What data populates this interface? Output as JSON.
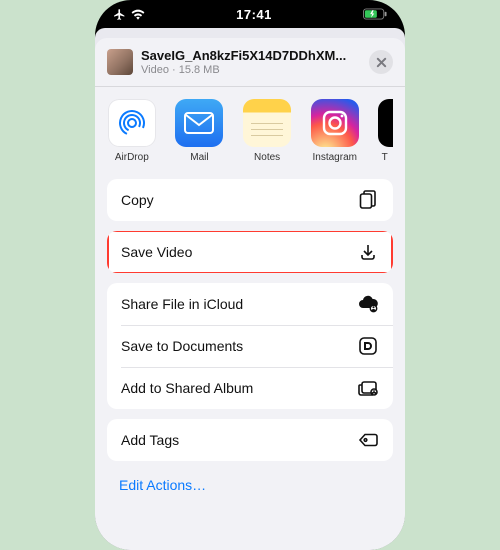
{
  "status": {
    "time": "17:41"
  },
  "file": {
    "name": "SaveIG_An8kzFi5X14D7DDhXM...",
    "kind": "Video",
    "size": "15.8 MB"
  },
  "apps": [
    {
      "id": "airdrop",
      "label": "AirDrop"
    },
    {
      "id": "mail",
      "label": "Mail"
    },
    {
      "id": "notes",
      "label": "Notes"
    },
    {
      "id": "instagram",
      "label": "Instagram"
    }
  ],
  "partial_app_label_fragment": "T",
  "actions": {
    "copy": "Copy",
    "save_video": "Save Video",
    "share_icloud": "Share File in iCloud",
    "save_documents": "Save to Documents",
    "add_shared_album": "Add to Shared Album",
    "add_tags": "Add Tags"
  },
  "edit_label": "Edit Actions…",
  "highlight_color": "#ff3b30"
}
